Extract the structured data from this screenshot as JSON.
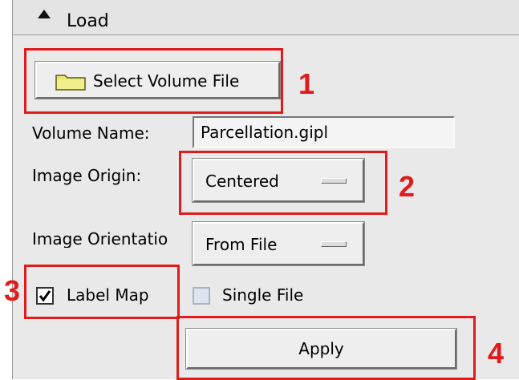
{
  "section": {
    "title": "Load",
    "icon": "collapse-triangle-icon"
  },
  "select_volume_button": {
    "label": "Select Volume File",
    "icon": "folder-icon"
  },
  "volume_name": {
    "label": "Volume Name:",
    "value": "Parcellation.gipl"
  },
  "image_origin": {
    "label": "Image Origin:",
    "selected": "Centered"
  },
  "image_orientation": {
    "label": "Image Orientatio",
    "selected": "From File"
  },
  "label_map": {
    "label": "Label Map",
    "checked": true
  },
  "single_file": {
    "label": "Single File",
    "checked": false
  },
  "apply_button": {
    "label": "Apply"
  },
  "callouts": [
    "1",
    "2",
    "3",
    "4"
  ],
  "colors": {
    "callout": "#e11b1b",
    "panel": "#e9e9e9",
    "unchecked_box": "#dce4f0"
  }
}
